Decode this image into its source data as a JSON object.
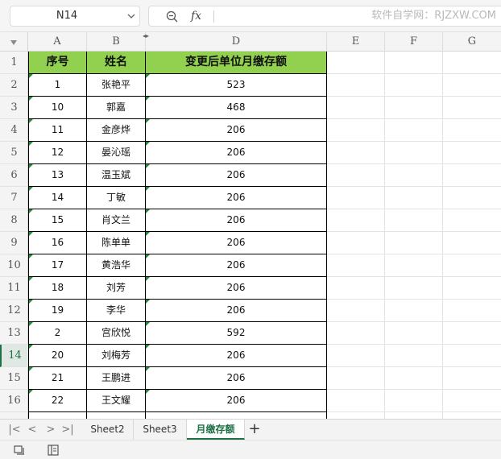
{
  "formula_bar": {
    "name_box": "N14",
    "fx_label": "fx",
    "formula": "",
    "watermark": "软件自学网：RJZXW.COM"
  },
  "columns": [
    "A",
    "B",
    "D",
    "E",
    "F",
    "G"
  ],
  "rows": [
    "1",
    "2",
    "3",
    "4",
    "5",
    "6",
    "7",
    "8",
    "9",
    "10",
    "11",
    "12",
    "13",
    "14",
    "15",
    "16"
  ],
  "active_row": "14",
  "table": {
    "headers": [
      "序号",
      "姓名",
      "变更后单位月缴存额"
    ],
    "rows": [
      [
        "1",
        "张艳平",
        "523"
      ],
      [
        "10",
        "郭嘉",
        "468"
      ],
      [
        "11",
        "金彦烨",
        "206"
      ],
      [
        "12",
        "晏沁瑶",
        "206"
      ],
      [
        "13",
        "温玉斌",
        "206"
      ],
      [
        "14",
        "丁敏",
        "206"
      ],
      [
        "15",
        "肖文兰",
        "206"
      ],
      [
        "16",
        "陈单单",
        "206"
      ],
      [
        "17",
        "黄浩华",
        "206"
      ],
      [
        "18",
        "刘芳",
        "206"
      ],
      [
        "19",
        "李华",
        "206"
      ],
      [
        "2",
        "宫欣悦",
        "592"
      ],
      [
        "20",
        "刘梅芳",
        "206"
      ],
      [
        "21",
        "王鹏进",
        "206"
      ],
      [
        "22",
        "王文耀",
        "206"
      ]
    ]
  },
  "sheet_tabs": {
    "tabs": [
      "Sheet2",
      "Sheet3",
      "月缴存额"
    ],
    "active": "月缴存额",
    "add_label": "+"
  },
  "colors": {
    "header_fill": "#92d050",
    "accent": "#1e7145",
    "error_triangle": "#1e8a3c"
  }
}
